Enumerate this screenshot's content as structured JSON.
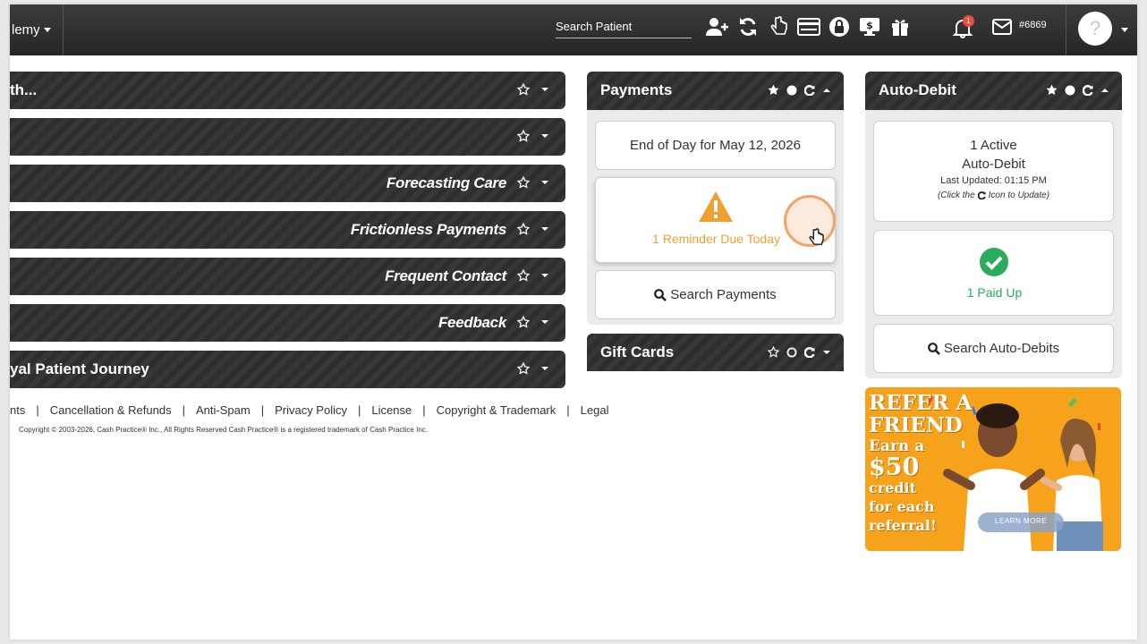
{
  "topbar": {
    "brand_label": "lemy",
    "search_placeholder": "Search Patient",
    "notification_count": "1",
    "account_number": "#6869",
    "avatar_glyph": "?"
  },
  "left_bars": [
    {
      "title": "th...",
      "align": "left"
    },
    {
      "title": "",
      "align": "right"
    },
    {
      "title": "Forecasting Care",
      "align": "right"
    },
    {
      "title": "Frictionless Payments",
      "align": "right"
    },
    {
      "title": "Frequent Contact",
      "align": "right"
    },
    {
      "title": "Feedback",
      "align": "right"
    },
    {
      "title": "yal Patient Journey",
      "align": "left"
    }
  ],
  "payments": {
    "title": "Payments",
    "end_of_day": "End of Day for May 12, 2026",
    "reminder": "1 Reminder Due Today",
    "search_label": "Search Payments"
  },
  "gift_cards": {
    "title": "Gift Cards"
  },
  "auto_debit": {
    "title": "Auto-Debit",
    "active_line1": "1 Active",
    "active_line2": "Auto-Debit",
    "last_updated": "Last Updated: 01:15 PM",
    "hint_prefix": "(Click the",
    "hint_suffix": "Icon to Update)",
    "paid_up": "1 Paid Up",
    "search_label": "Search Auto-Debits"
  },
  "ad": {
    "line1": "REFER A",
    "line2": "FRIEND",
    "line3": "Earn a",
    "line4": "$50",
    "line5": "credit",
    "line6": "for each",
    "line7": "referral!",
    "button": "LEARN MORE"
  },
  "footer": {
    "links": [
      "nts",
      "Cancellation & Refunds",
      "Anti-Spam",
      "Privacy Policy",
      "License",
      "Copyright & Trademark",
      "Legal"
    ],
    "copyright": "Copyright © 2003-2026, Cash Practice® Inc., All Rights Reserved Cash Practice® is a registered trademark of Cash Practice Inc."
  },
  "colors": {
    "warning": "#f0a030",
    "success": "#2bac5c",
    "accent_ad": "#f7a21b"
  }
}
